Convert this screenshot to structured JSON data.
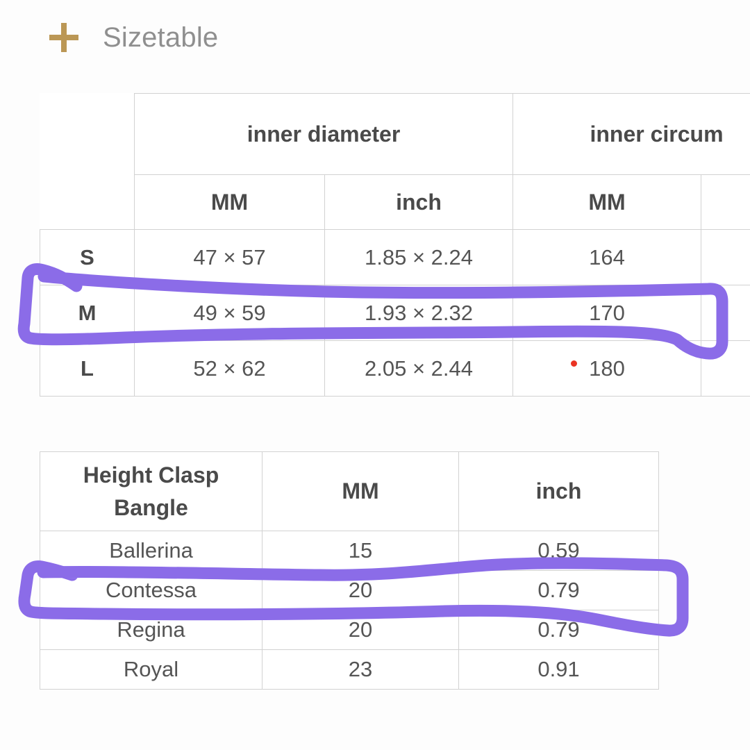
{
  "header": {
    "add_icon": "plus-icon",
    "title": "Sizetable",
    "icon_color": "#bb9755",
    "title_color": "#8f8f8f"
  },
  "colors": {
    "background": "#fdfdfd",
    "border": "#d2d2d2",
    "text": "#555555",
    "heading_text": "#4a4a4a",
    "annotation_purple": "#8b6ce8",
    "cursor_dot_red": "#ea3323",
    "accent_gold": "#bb9755"
  },
  "size_table": {
    "name": "size-table",
    "corner_label": "",
    "group_headers": [
      {
        "label": "inner diameter",
        "colspan": 2
      },
      {
        "label": "inner circum",
        "colspan": 2,
        "truncated": true
      }
    ],
    "unit_headers": [
      "MM",
      "inch",
      "MM",
      ""
    ],
    "rows": [
      {
        "size": "S",
        "diameter_mm": "47 × 57",
        "diameter_inch": "1.85 × 2.24",
        "circumference_mm": "164",
        "circumference_inch": ""
      },
      {
        "size": "M",
        "diameter_mm": "49 × 59",
        "diameter_inch": "1.93 × 2.32",
        "circumference_mm": "170",
        "circumference_inch": ""
      },
      {
        "size": "L",
        "diameter_mm": "52 × 62",
        "diameter_inch": "2.05 × 2.44",
        "circumference_mm": "180",
        "circumference_inch": ""
      }
    ],
    "highlighted_row": "M"
  },
  "clasp_table": {
    "name": "height-clasp-bangle-table",
    "headers": [
      "Height Clasp Bangle",
      "MM",
      "inch"
    ],
    "header_line_1": "Height Clasp",
    "header_line_2": "Bangle",
    "rows": [
      {
        "name": "Ballerina",
        "mm": "15",
        "inch": "0.59"
      },
      {
        "name": "Contessa",
        "mm": "20",
        "inch": "0.79"
      },
      {
        "name": "Regina",
        "mm": "20",
        "inch": "0.79"
      },
      {
        "name": "Royal",
        "mm": "23",
        "inch": "0.91"
      }
    ],
    "highlighted_row": "Contessa"
  },
  "annotations": [
    {
      "name": "purple-highlight-row-m",
      "target": "M",
      "shape": "hand-drawn-rounded-rectangle",
      "color": "#8b6ce8"
    },
    {
      "name": "purple-highlight-row-contessa",
      "target": "Contessa",
      "shape": "hand-drawn-rounded-rectangle",
      "color": "#8b6ce8"
    },
    {
      "name": "cursor-dot",
      "target": "180",
      "shape": "dot",
      "color": "#ea3323"
    }
  ]
}
